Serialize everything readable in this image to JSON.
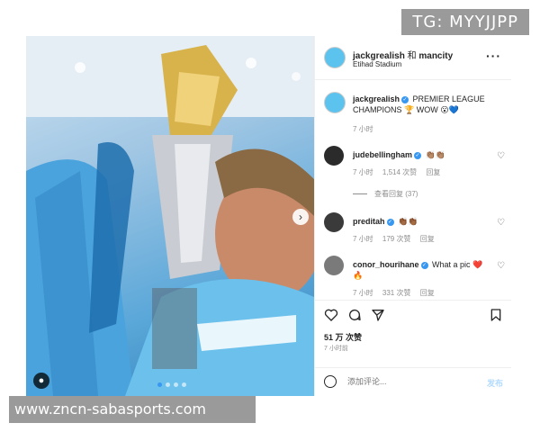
{
  "watermarks": {
    "top": "TG: MYYJJPP",
    "bottom": "www.zncn-sabasports.com"
  },
  "post": {
    "header": {
      "user": "jackgrealish",
      "connector": "和",
      "collab": "mancity",
      "location": "Etihad Stadium"
    },
    "caption": {
      "user": "jackgrealish",
      "text": "PREMIER LEAGUE CHAMPIONS 🏆 WOW 😮💙",
      "time": "7 小时"
    },
    "comments": [
      {
        "user": "judebellingham",
        "text": "👏🏽👏🏽",
        "time": "7 小时",
        "likes": "1,514 次赞",
        "reply": "回复",
        "view_replies": "查看回复 (37)"
      },
      {
        "user": "preditah",
        "text": "👏🏾👏🏾",
        "time": "7 小时",
        "likes": "179 次赞",
        "reply": "回复"
      },
      {
        "user": "conor_hourihane",
        "text": "What a pic ❤️ 🔥",
        "time": "7 小时",
        "likes": "331 次赞",
        "reply": "回复"
      }
    ],
    "likes_total": "51 万 次赞",
    "posted_ago": "7 小时前",
    "add_comment_placeholder": "添加评论...",
    "post_label": "发布"
  },
  "icons": {
    "more": "more-icon",
    "heart": "heart-icon",
    "comment": "comment-icon",
    "share": "share-icon",
    "save": "bookmark-icon",
    "emoji": "emoji-icon",
    "next": "chevron-right-icon",
    "tag": "user-tag-icon"
  },
  "colors": {
    "link_blue": "#3897f0",
    "muted": "#8e8e8e",
    "text": "#262626"
  }
}
